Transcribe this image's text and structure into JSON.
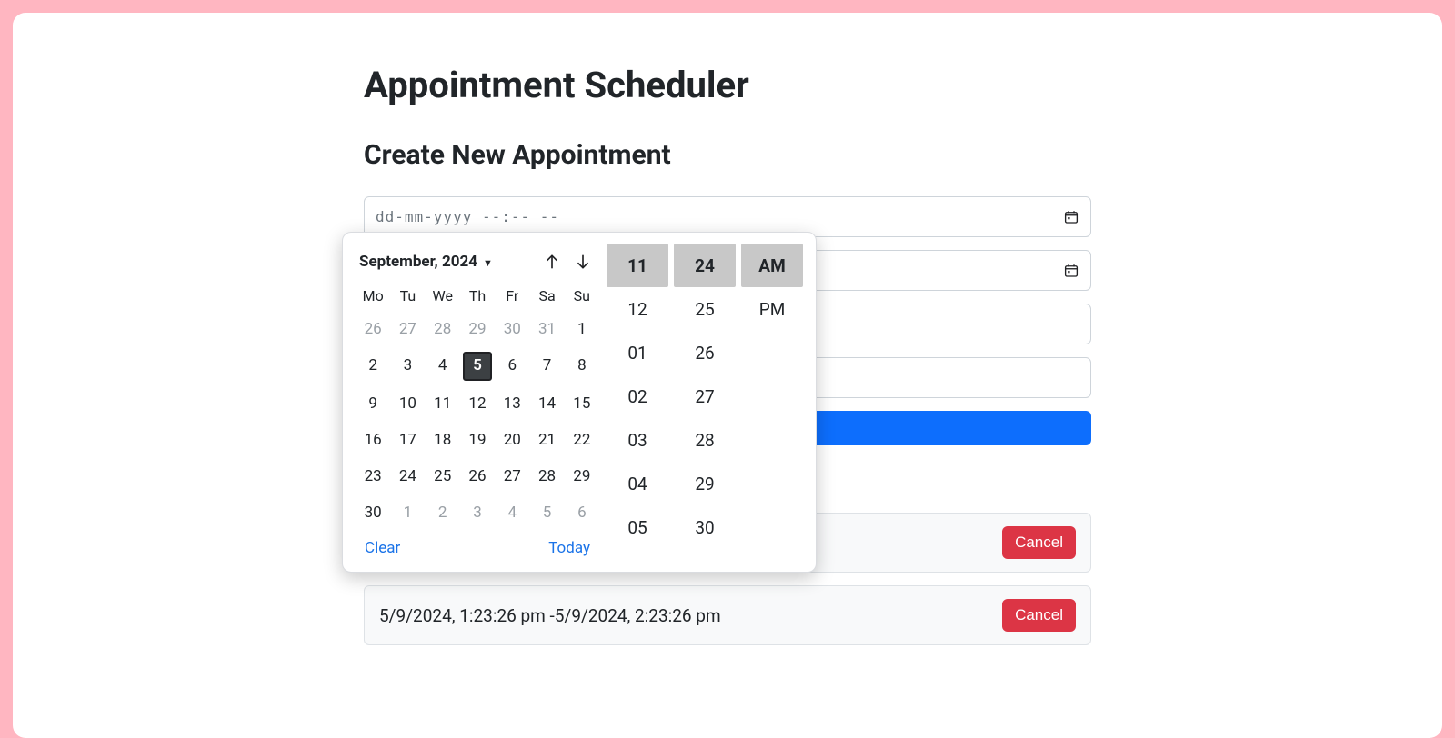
{
  "page": {
    "title": "Appointment Scheduler",
    "subtitle": "Create New Appointment"
  },
  "inputs": {
    "datetime_placeholder": "dd-mm-yyyy --:-- --"
  },
  "datepicker": {
    "month_label": "September, 2024",
    "dow": [
      "Mo",
      "Tu",
      "We",
      "Th",
      "Fr",
      "Sa",
      "Su"
    ],
    "weeks": [
      [
        {
          "d": "26",
          "muted": true
        },
        {
          "d": "27",
          "muted": true
        },
        {
          "d": "28",
          "muted": true
        },
        {
          "d": "29",
          "muted": true
        },
        {
          "d": "30",
          "muted": true
        },
        {
          "d": "31",
          "muted": true
        },
        {
          "d": "1"
        }
      ],
      [
        {
          "d": "2"
        },
        {
          "d": "3"
        },
        {
          "d": "4"
        },
        {
          "d": "5",
          "today": true
        },
        {
          "d": "6"
        },
        {
          "d": "7"
        },
        {
          "d": "8"
        }
      ],
      [
        {
          "d": "9"
        },
        {
          "d": "10"
        },
        {
          "d": "11"
        },
        {
          "d": "12"
        },
        {
          "d": "13"
        },
        {
          "d": "14"
        },
        {
          "d": "15"
        }
      ],
      [
        {
          "d": "16"
        },
        {
          "d": "17"
        },
        {
          "d": "18"
        },
        {
          "d": "19"
        },
        {
          "d": "20"
        },
        {
          "d": "21"
        },
        {
          "d": "22"
        }
      ],
      [
        {
          "d": "23"
        },
        {
          "d": "24"
        },
        {
          "d": "25"
        },
        {
          "d": "26"
        },
        {
          "d": "27"
        },
        {
          "d": "28"
        },
        {
          "d": "29"
        }
      ],
      [
        {
          "d": "30"
        },
        {
          "d": "1",
          "muted": true
        },
        {
          "d": "2",
          "muted": true
        },
        {
          "d": "3",
          "muted": true
        },
        {
          "d": "4",
          "muted": true
        },
        {
          "d": "5",
          "muted": true
        },
        {
          "d": "6",
          "muted": true
        }
      ]
    ],
    "clear_label": "Clear",
    "today_label": "Today",
    "hours": {
      "selected": "11",
      "options": [
        "12",
        "01",
        "02",
        "03",
        "04",
        "05"
      ]
    },
    "minutes": {
      "selected": "24",
      "options": [
        "25",
        "26",
        "27",
        "28",
        "29",
        "30"
      ]
    },
    "ampm": {
      "selected": "AM",
      "options": [
        "PM"
      ]
    }
  },
  "appointments": {
    "row1": {
      "cancel_label": "Cancel"
    },
    "row2": {
      "time_text": "5/9/2024, 1:23:26 pm -5/9/2024, 2:23:26 pm",
      "cancel_label": "Cancel"
    }
  }
}
